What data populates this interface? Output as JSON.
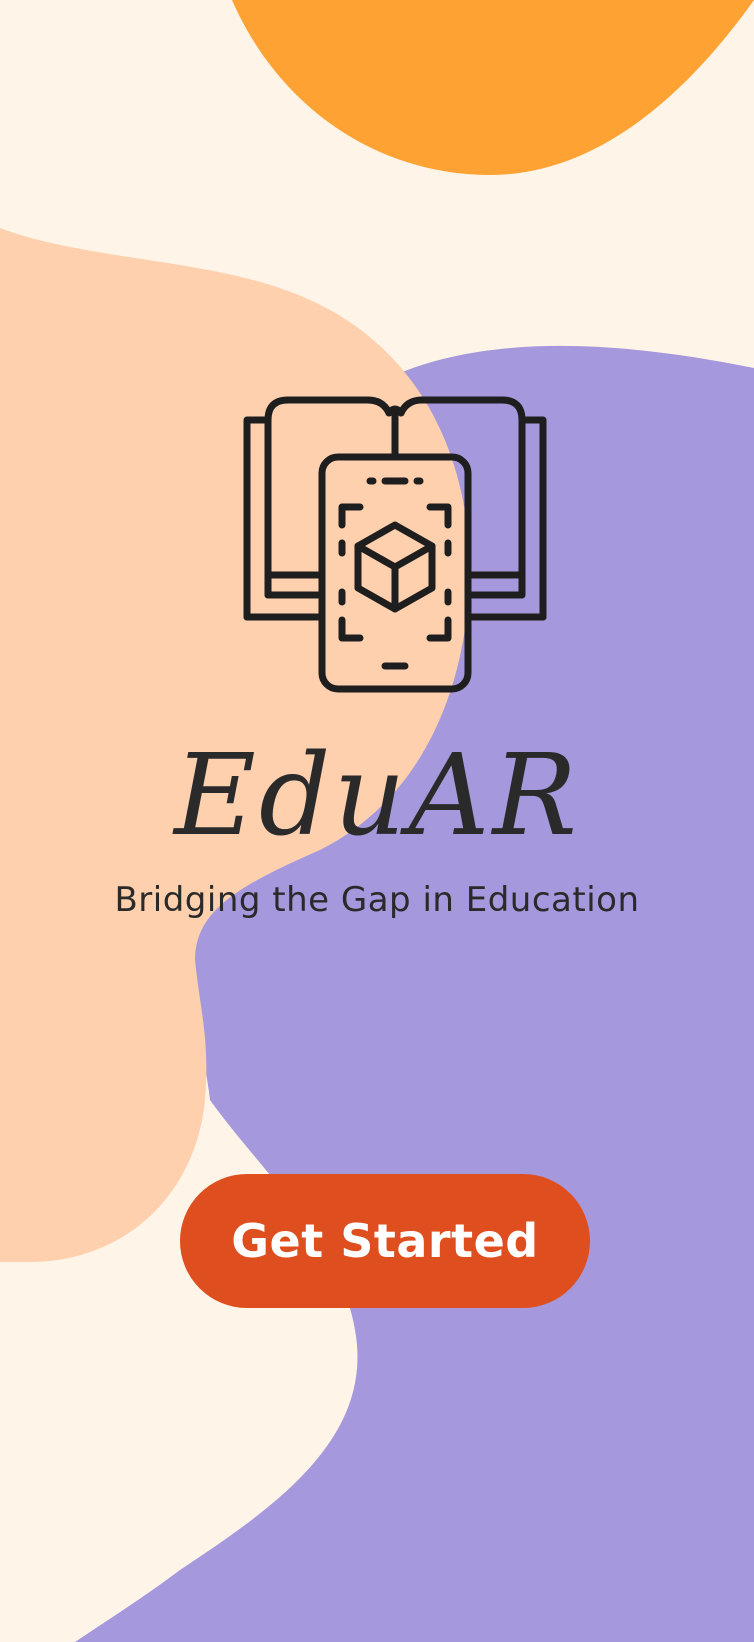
{
  "app": {
    "name": "EduAR",
    "tagline": "Bridging the Gap in Education"
  },
  "cta": {
    "label": "Get Started"
  },
  "icons": {
    "logo": "book-phone-ar-cube-icon"
  },
  "colors": {
    "background": "#FFF4E8",
    "orange_blob": "#FFA234",
    "peach_blob": "#FFD0AE",
    "purple_blob": "#A698DC",
    "button": "#DE4E1F",
    "button_text": "#FFFFFF",
    "text": "#2A2A2A"
  }
}
